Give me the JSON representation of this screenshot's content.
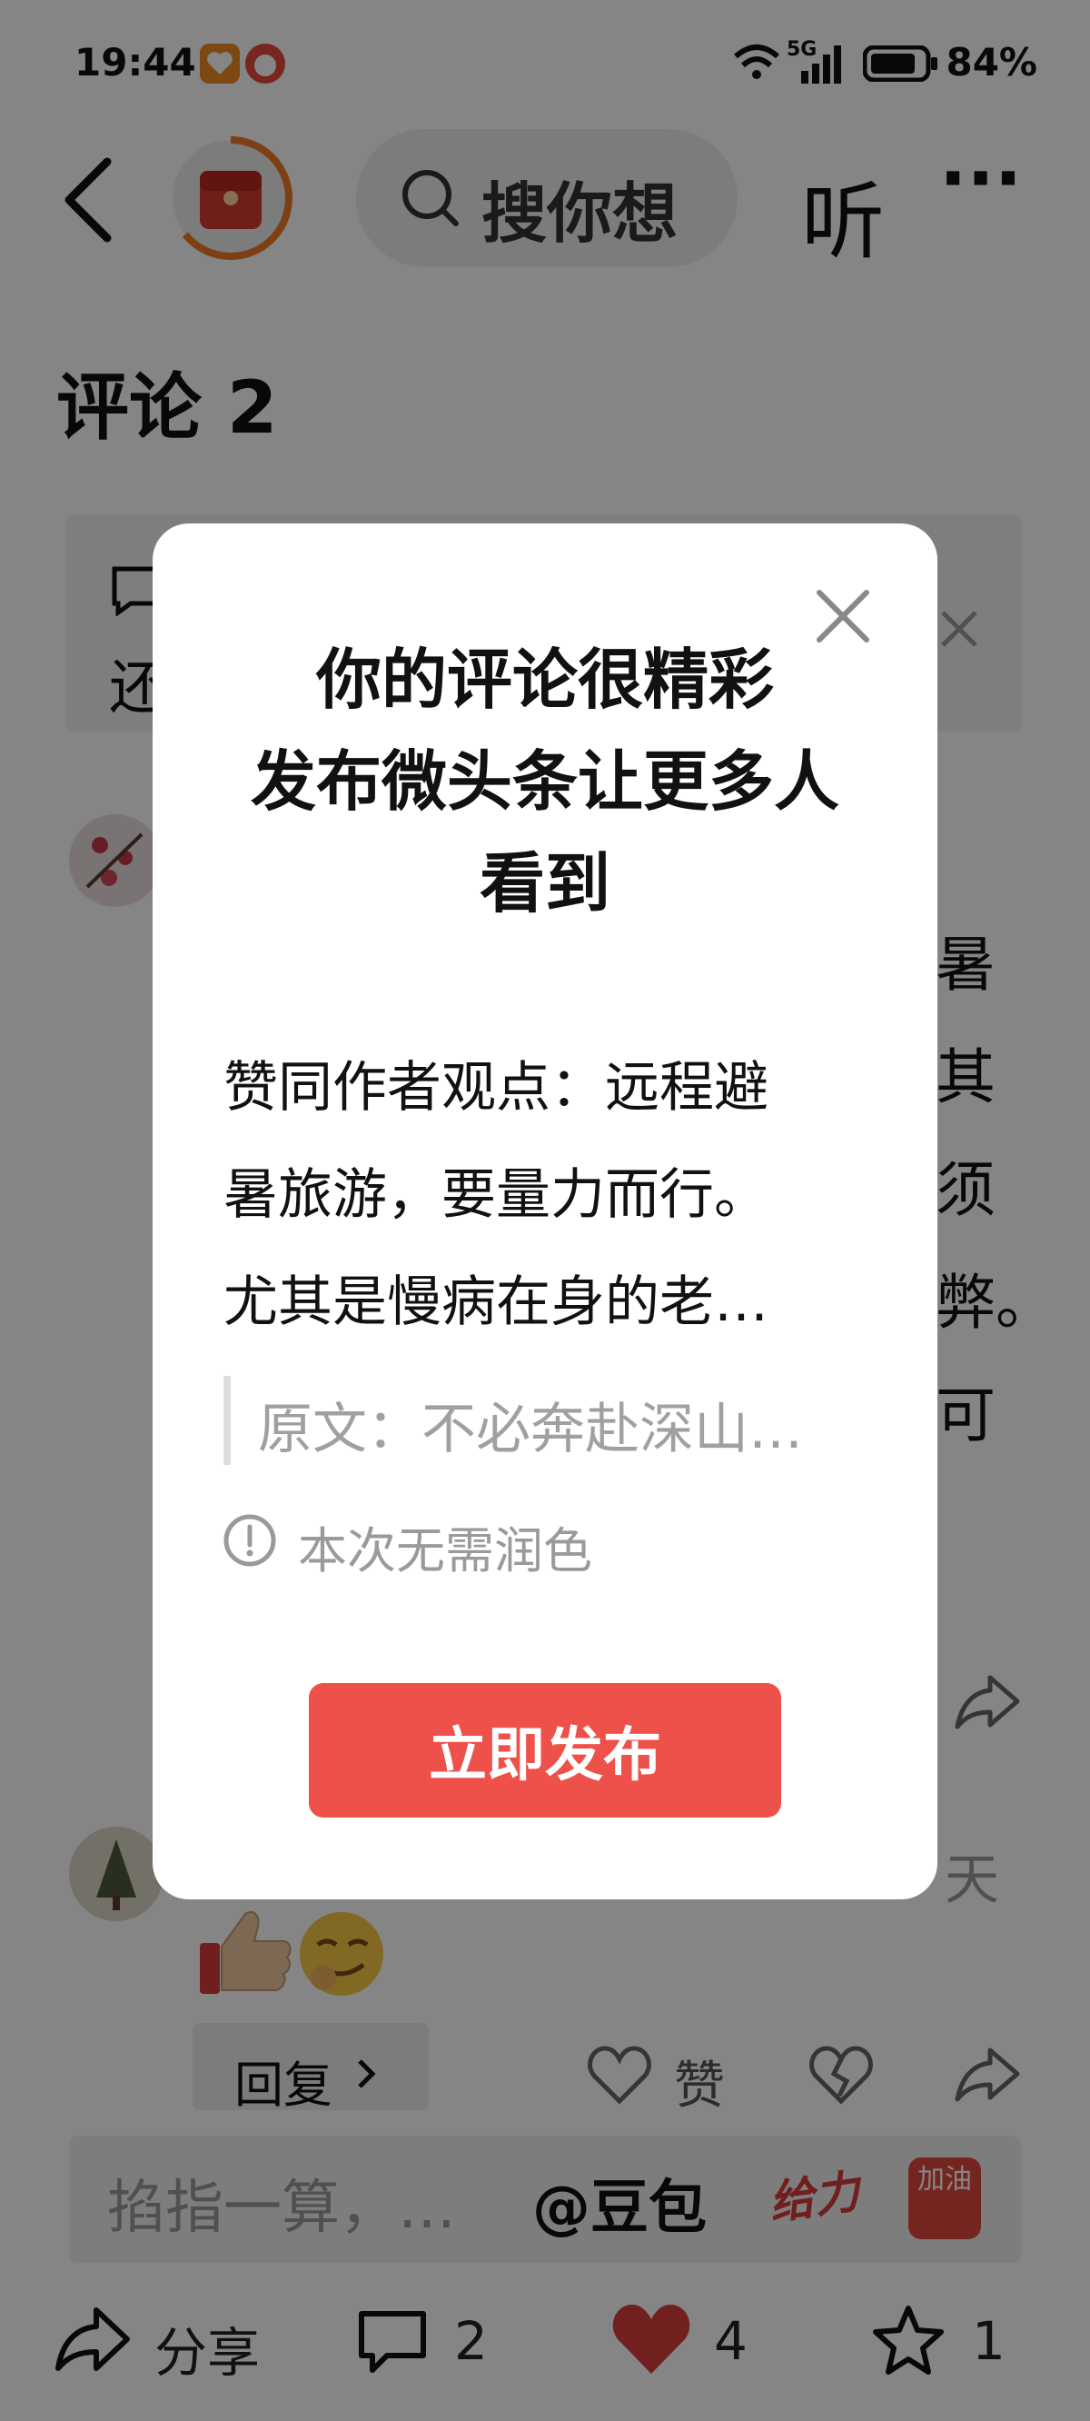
{
  "status_bar": {
    "time": "19:44",
    "network": "5G",
    "battery": "84%"
  },
  "header": {
    "search_placeholder": "搜你想",
    "listen_label": "听",
    "more_label": "···"
  },
  "comments_section": {
    "title": "评论 2",
    "tip_prefix": "还",
    "comment_fragment_lines": [
      "暑",
      "其",
      "须",
      "弊。",
      "可"
    ],
    "reply_label": "回复",
    "like_label": "赞",
    "second_comment_fragment": "天"
  },
  "comment_input": {
    "placeholder": "掐指一算，…",
    "mention": "@豆包",
    "sticker_1": "给力",
    "sticker_2": "加油"
  },
  "bottom_bar": {
    "share_label": "分享",
    "comment_count": "2",
    "like_count": "4",
    "favorite_count": "1"
  },
  "modal": {
    "title_lines": [
      "你的评论很精彩",
      "发布微头条让更多人",
      "看到"
    ],
    "comment_lines": [
      "赞同作者观点：远程避",
      "暑旅游，要量力而行。",
      "尤其是慢病在身的老…"
    ],
    "quote": "原文：不必奔赴深山…",
    "hint": "本次无需润色",
    "publish_label": "立即发布"
  },
  "colors": {
    "accent": "#ee5149",
    "like_heart": "#d93c3c",
    "overlay": "rgba(0,0,0,0.48)"
  }
}
